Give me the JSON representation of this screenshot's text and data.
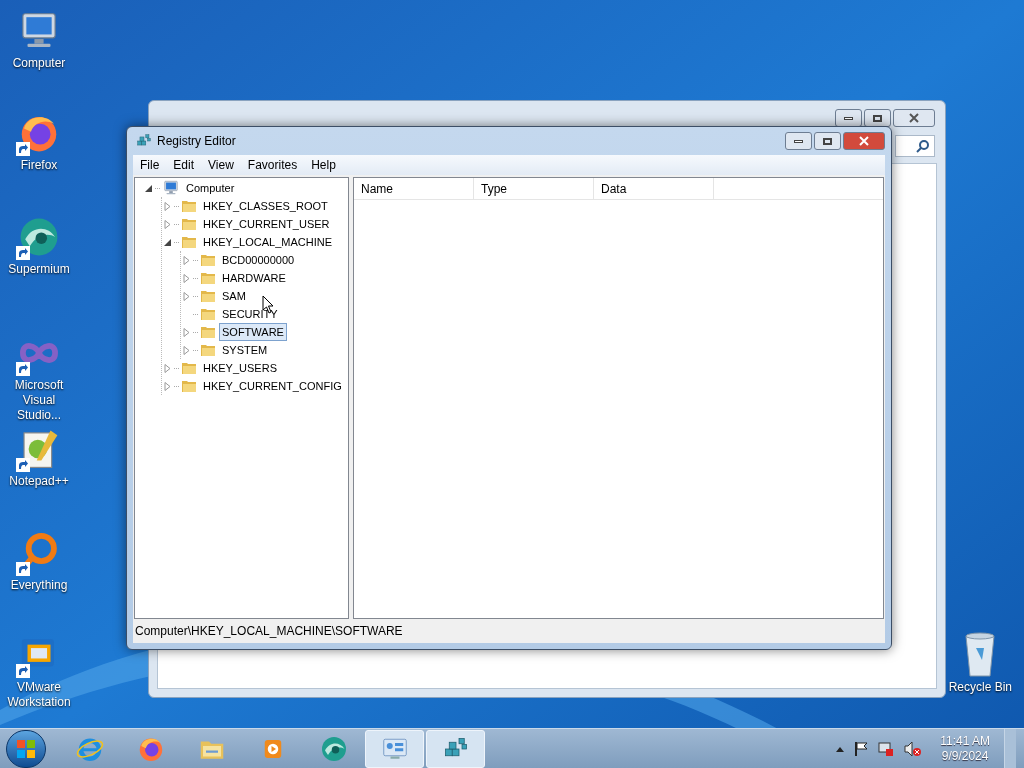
{
  "desktop_icons": [
    {
      "kind": "computer",
      "label": "Computer",
      "shortcut": false
    },
    {
      "kind": "firefox",
      "label": "Firefox",
      "shortcut": true
    },
    {
      "kind": "supermium",
      "label": "Supermium",
      "shortcut": true
    },
    {
      "kind": "vstudio",
      "label": "Microsoft Visual Studio...",
      "shortcut": true
    },
    {
      "kind": "notepad",
      "label": "Notepad++",
      "shortcut": true
    },
    {
      "kind": "everything",
      "label": "Everything",
      "shortcut": true
    },
    {
      "kind": "vmware",
      "label": "VMware Workstation",
      "shortcut": true
    }
  ],
  "recycle_bin": {
    "label": "Recycle Bin"
  },
  "window": {
    "title": "Registry Editor",
    "menu": [
      "File",
      "Edit",
      "View",
      "Favorites",
      "Help"
    ],
    "tree": [
      {
        "kind": "computer",
        "label": "Computer",
        "expandable": true,
        "expanded": true,
        "selected": false,
        "children": [
          {
            "label": "HKEY_CLASSES_ROOT",
            "expandable": true,
            "expanded": false,
            "selected": false
          },
          {
            "label": "HKEY_CURRENT_USER",
            "expandable": true,
            "expanded": false,
            "selected": false
          },
          {
            "label": "HKEY_LOCAL_MACHINE",
            "expandable": true,
            "expanded": true,
            "selected": false,
            "children": [
              {
                "label": "BCD00000000",
                "expandable": true,
                "expanded": false,
                "selected": false
              },
              {
                "label": "HARDWARE",
                "expandable": true,
                "expanded": false,
                "selected": false
              },
              {
                "label": "SAM",
                "expandable": true,
                "expanded": false,
                "selected": false
              },
              {
                "label": "SECURITY",
                "expandable": false,
                "expanded": false,
                "selected": false
              },
              {
                "label": "SOFTWARE",
                "expandable": true,
                "expanded": false,
                "selected": true
              },
              {
                "label": "SYSTEM",
                "expandable": true,
                "expanded": false,
                "selected": false
              }
            ]
          },
          {
            "label": "HKEY_USERS",
            "expandable": true,
            "expanded": false,
            "selected": false
          },
          {
            "label": "HKEY_CURRENT_CONFIG",
            "expandable": true,
            "expanded": false,
            "selected": false
          }
        ]
      }
    ],
    "columns": [
      "Name",
      "Type",
      "Data"
    ],
    "status_bar": "Computer\\HKEY_LOCAL_MACHINE\\SOFTWARE"
  },
  "taskbar": {
    "apps": [
      {
        "kind": "ie",
        "selected": false
      },
      {
        "kind": "firefox",
        "selected": false
      },
      {
        "kind": "explorer",
        "selected": false
      },
      {
        "kind": "media",
        "selected": false
      },
      {
        "kind": "supermium",
        "selected": false
      },
      {
        "kind": "control",
        "selected": true
      },
      {
        "kind": "regedit",
        "selected": true
      }
    ],
    "time": "11:41 AM",
    "date": "9/9/2024"
  }
}
